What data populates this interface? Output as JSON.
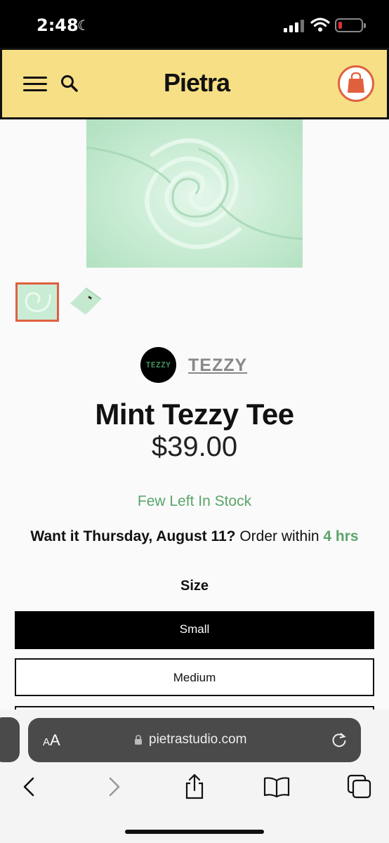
{
  "status": {
    "time": "2:48"
  },
  "header": {
    "logo": "Pietra"
  },
  "brand": {
    "avatar_text": "TEZZY",
    "name": "TEZZY"
  },
  "product": {
    "title": "Mint Tezzy Tee",
    "price": "$39.00",
    "stock": "Few Left In Stock",
    "delivery_prefix": "Want it Thursday, August 11?",
    "delivery_mid": " Order within ",
    "delivery_time": "4 hrs"
  },
  "size": {
    "label": "Size",
    "options": [
      "Small",
      "Medium"
    ],
    "selected": "Small"
  },
  "browser": {
    "aa_small": "A",
    "aa_big": "A",
    "url": "pietrastudio.com"
  },
  "colors": {
    "header_bg": "#f6df85",
    "accent": "#e0603e",
    "stock_green": "#5aa56a",
    "mint": "#cdeed8"
  }
}
